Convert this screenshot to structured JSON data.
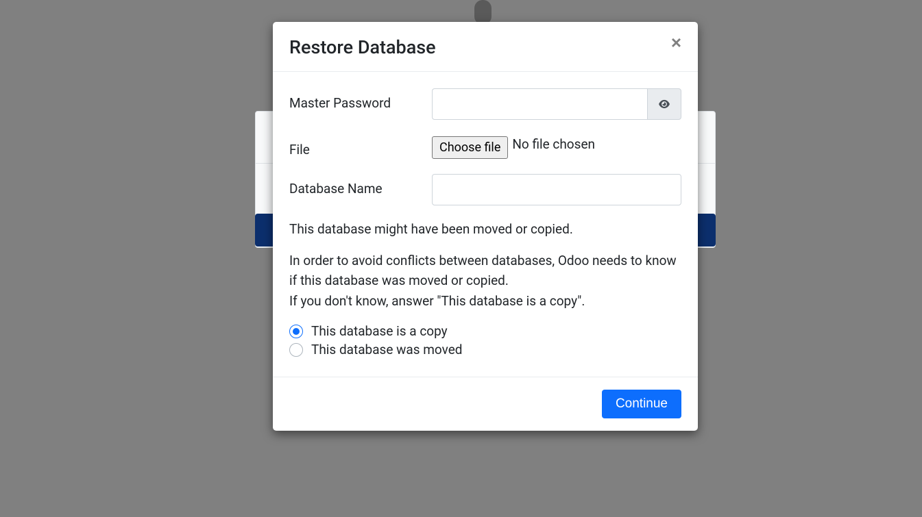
{
  "modal": {
    "title": "Restore Database",
    "labels": {
      "master_password": "Master Password",
      "file": "File",
      "database_name": "Database Name"
    },
    "file_input": {
      "button": "Choose file",
      "status": "No file chosen"
    },
    "info": {
      "line1": "This database might have been moved or copied.",
      "line2a": "In order to avoid conflicts between databases, Odoo needs to know if this database was moved or copied.",
      "line2b": "If you don't know, answer \"This database is a copy\"."
    },
    "radios": {
      "copy": "This database is a copy",
      "moved": "This database was moved",
      "selected": "copy"
    },
    "buttons": {
      "continue": "Continue"
    },
    "values": {
      "master_password": "",
      "database_name": ""
    }
  }
}
